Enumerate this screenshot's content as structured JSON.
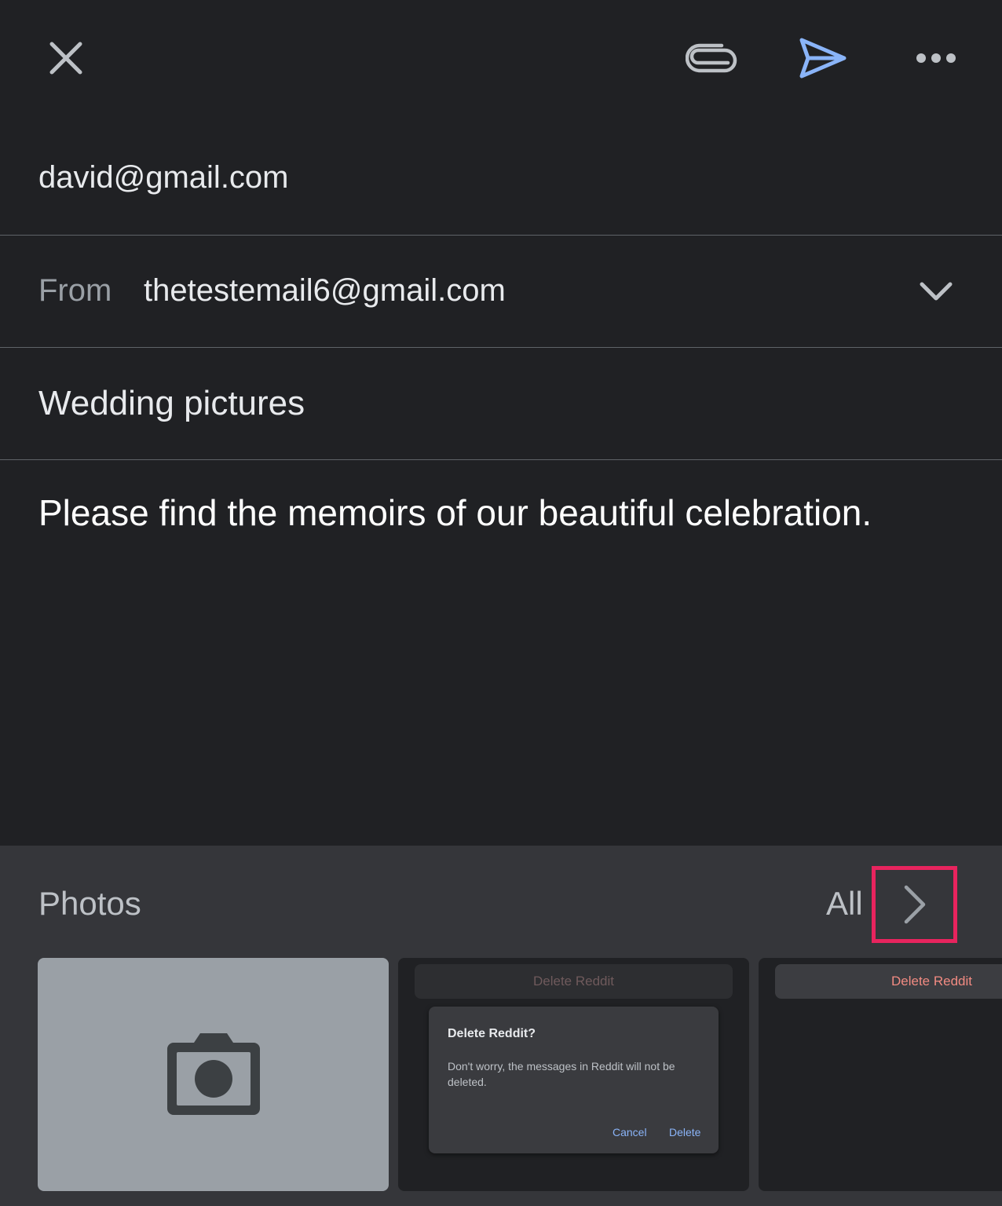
{
  "toolbar": {
    "close_icon": "close-icon",
    "attach_icon": "paperclip-icon",
    "send_icon": "send-icon",
    "more_icon": "more-horizontal-icon",
    "send_color": "#8ab4f8"
  },
  "compose": {
    "to": "david@gmail.com",
    "from_label": "From",
    "from": "thetestemail6@gmail.com",
    "subject": "Wedding pictures",
    "body": "Please find the memoirs of our beautiful celebration."
  },
  "photos": {
    "title": "Photos",
    "all_label": "All",
    "highlight_color": "#e8245e",
    "tiles": [
      {
        "type": "camera",
        "icon": "camera-icon"
      },
      {
        "type": "screenshot",
        "bar_text": "Delete Reddit",
        "dialog_title": "Delete Reddit?",
        "dialog_message": "Don't worry, the messages in Reddit will not be deleted.",
        "cancel": "Cancel",
        "delete": "Delete"
      },
      {
        "type": "screenshot",
        "bar_text": "Delete Reddit"
      }
    ]
  }
}
